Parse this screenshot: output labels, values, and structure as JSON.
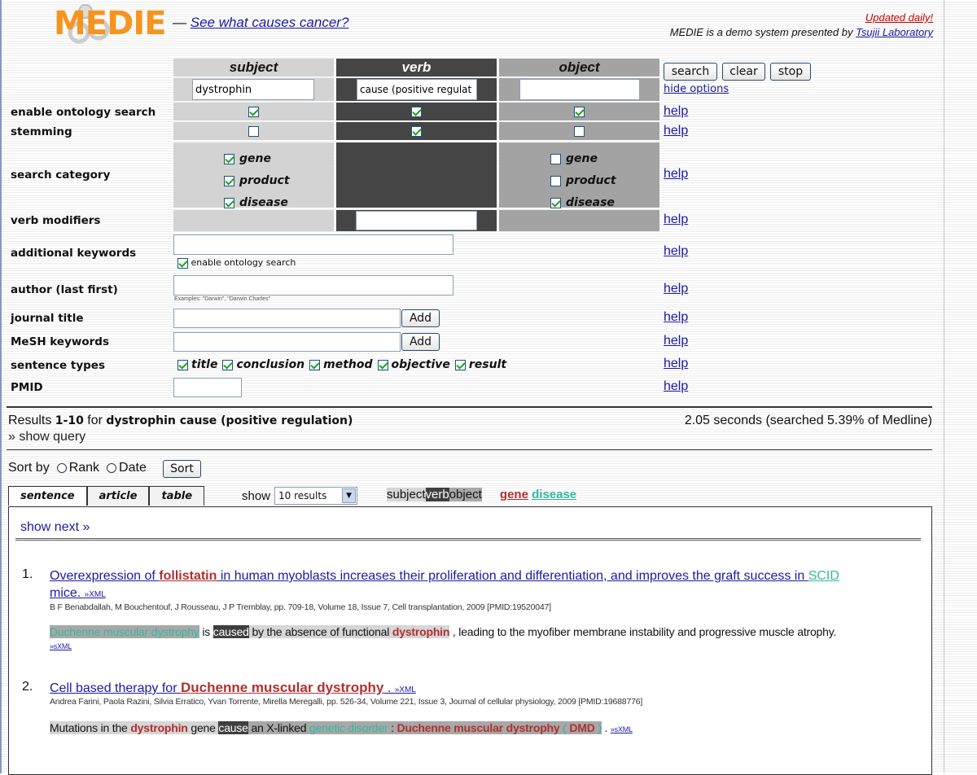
{
  "header": {
    "logo_text": "MEDIE",
    "dash": "—",
    "tagline": "See what causes cancer?",
    "updated": "Updated daily!",
    "demo_text": "MEDIE is a demo system presented by ",
    "lab_link": "Tsujii Laboratory"
  },
  "form": {
    "columns": {
      "subject": "subject",
      "verb": "verb",
      "object": "object"
    },
    "values": {
      "subject": "dystrophin",
      "verb": "cause (positive regulat",
      "object": ""
    },
    "buttons": {
      "search": "search",
      "clear": "clear",
      "stop": "stop",
      "hide_options": "hide options",
      "add": "Add"
    },
    "labels": {
      "ontology": "enable ontology search",
      "stemming": "stemming",
      "category": "search category",
      "verb_mod": "verb modifiers",
      "keywords": "additional keywords",
      "author": "author (last first)",
      "journal": "journal title",
      "mesh": "MeSH keywords",
      "sentence_types": "sentence types",
      "pmid": "PMID"
    },
    "help": "help",
    "ontology": {
      "subject": true,
      "verb": true,
      "object": true
    },
    "stemming": {
      "subject": false,
      "verb": true,
      "object": false
    },
    "categories": {
      "gene": "gene",
      "product": "product",
      "disease": "disease"
    },
    "subject_categories": {
      "gene": true,
      "product": true,
      "disease": true
    },
    "object_categories": {
      "gene": false,
      "product": false,
      "disease": true
    },
    "keywords_ontology": "enable ontology search",
    "author_example": "Examples: \"Darwin\", \"Darwin Charles\"",
    "sentence_types": [
      {
        "label": "title",
        "checked": true
      },
      {
        "label": "conclusion",
        "checked": true
      },
      {
        "label": "method",
        "checked": true
      },
      {
        "label": "objective",
        "checked": true
      },
      {
        "label": "result",
        "checked": true
      }
    ]
  },
  "results": {
    "prefix": "Results ",
    "range": "1-10",
    "for": " for ",
    "query": "dystrophin cause (positive regulation)",
    "timing": "2.05 seconds (searched 5.39% of Medline)",
    "show_query": "» show query",
    "sort_label": "Sort by",
    "sort_rank": "Rank",
    "sort_date": "Date",
    "sort_button": "Sort",
    "tabs": [
      "sentence",
      "article",
      "table"
    ],
    "show_label": "show",
    "show_value": "10 results",
    "legend": {
      "subject": "subject",
      "verb": "verb",
      "object": "object",
      "gene": "gene",
      "disease": "disease"
    },
    "show_next": "show next »",
    "items": [
      {
        "num": "1.",
        "title_pre": "Overexpression of ",
        "title_gene": "follistatin",
        "title_mid": " in human myoblasts increases their proliferation and differentiation, and improves the graft success in ",
        "title_dis": "SCID",
        "title_end": "mice. ",
        "xml": "»XML",
        "meta": "B F Benabdallah, M Bouchentouf, J Rousseau, J P Tremblay, pp. 709-18, Volume 18, Issue 7, Cell transplantation, 2009 [PMID:19520047]",
        "s_subj": "Duchenne muscular dystrophy",
        "s_is": " is ",
        "s_verb": "caused",
        "s_obj_pre": " by the absence of functional ",
        "s_obj_gene": "dystrophin",
        "s_rest": " , leading to the myofiber membrane instability and progressive muscle atrophy.",
        "sxml": "»sXML"
      },
      {
        "num": "2.",
        "title_pre": "Cell based therapy for ",
        "title_gene": "Duchenne muscular dystrophy",
        "title_end": " . ",
        "xml": "»XML",
        "meta": "Andrea Farini, Paola Razini, Silvia Erratico, Yvan Torrente, Mirella Meregalli, pp. 526-34, Volume 221, Issue 3, Journal of cellular physiology, 2009 [PMID:19688776]",
        "s_pre": "Mutations in the ",
        "s_gene": "dystrophin",
        "s_gene2": " gene ",
        "s_verb": "cause",
        "s_obj_pre": " an X-linked ",
        "s_obj_dis": "genetic disorder",
        "s_colon": " : ",
        "s_obj_gene": "Duchenne muscular dystrophy",
        "s_paren": " ( ",
        "s_dmd": "DMD",
        "s_close": " )",
        "s_end": " . ",
        "sxml": "»sXML"
      }
    ]
  },
  "colors": {
    "logo": "#f7941d",
    "gene": "#b03030",
    "disease": "#35b8a0",
    "link": "#1a1aa6",
    "verb_bg": "#454545"
  }
}
